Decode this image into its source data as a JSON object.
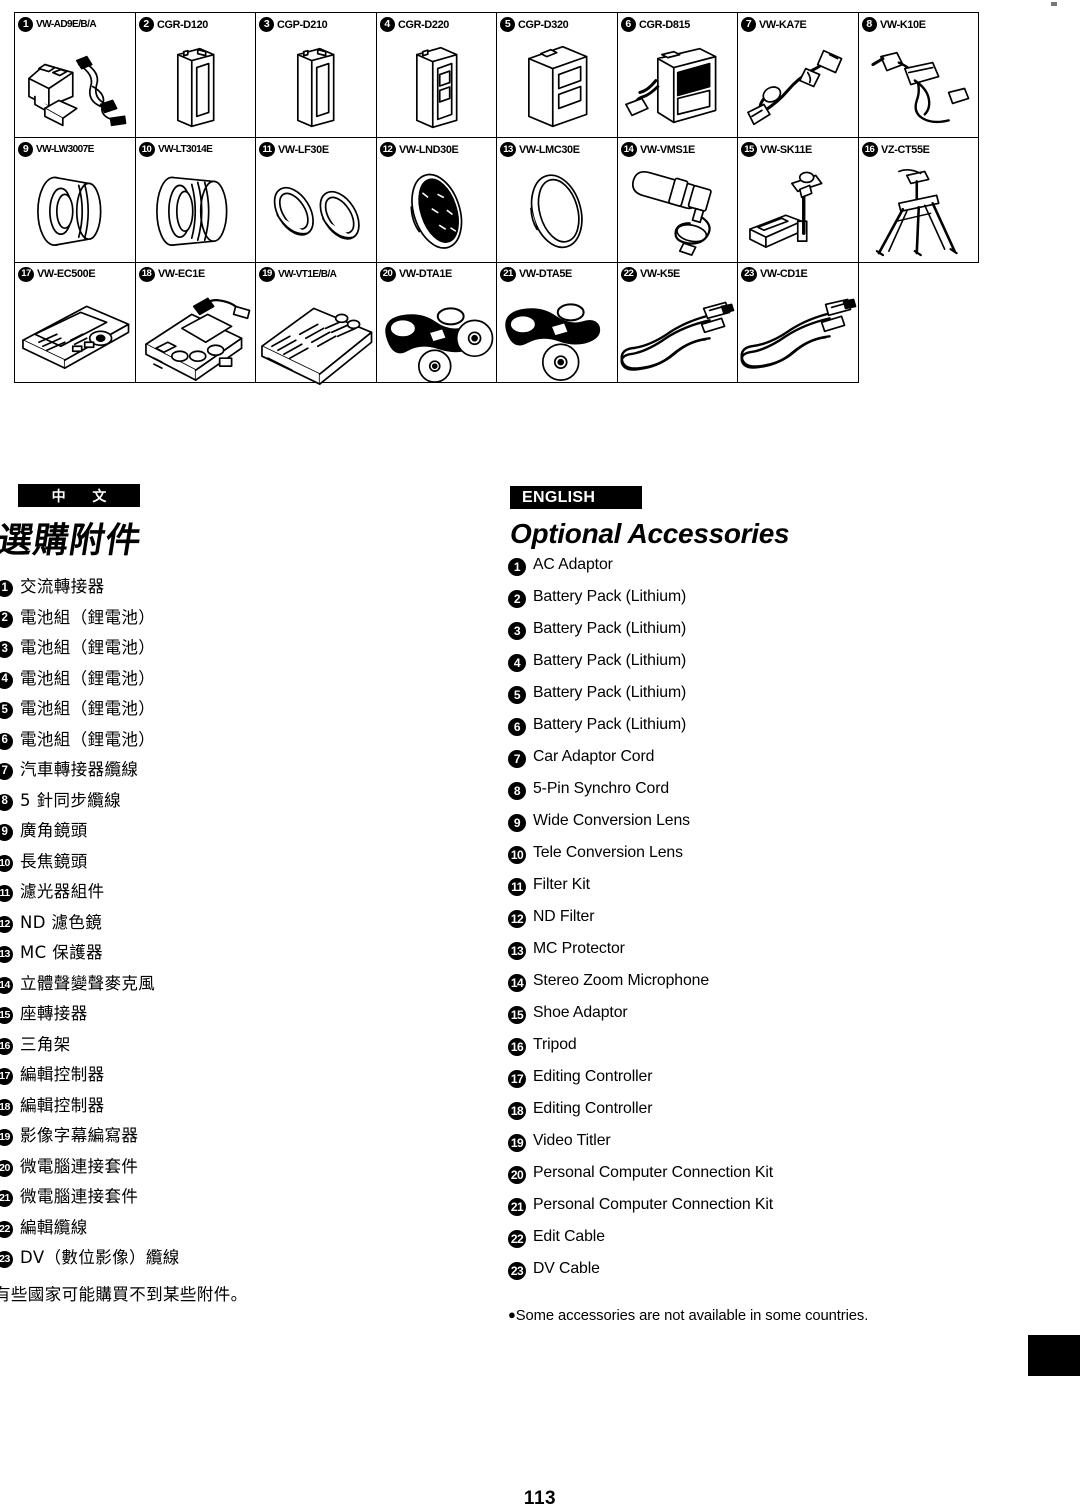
{
  "table": {
    "rows": [
      [
        {
          "n": "1",
          "code": "VW-AD9E/B/A",
          "art": "ac-adaptor"
        },
        {
          "n": "2",
          "code": "CGR-D120",
          "art": "battery-slim"
        },
        {
          "n": "3",
          "code": "CGP-D210",
          "art": "battery-slim"
        },
        {
          "n": "4",
          "code": "CGR-D220",
          "art": "battery-med"
        },
        {
          "n": "5",
          "code": "CGP-D320",
          "art": "battery-large"
        },
        {
          "n": "6",
          "code": "CGR-D815",
          "art": "battery-charger"
        },
        {
          "n": "7",
          "code": "VW-KA7E",
          "art": "car-adaptor-cord"
        },
        {
          "n": "8",
          "code": "VW-K10E",
          "art": "synchro-cord"
        }
      ],
      [
        {
          "n": "9",
          "code": "VW-LW3007E",
          "art": "wide-lens"
        },
        {
          "n": "10",
          "code": "VW-LT3014E",
          "art": "tele-lens"
        },
        {
          "n": "11",
          "code": "VW-LF30E",
          "art": "filter-kit"
        },
        {
          "n": "12",
          "code": "VW-LND30E",
          "art": "nd-filter"
        },
        {
          "n": "13",
          "code": "VW-LMC30E",
          "art": "mc-protector"
        },
        {
          "n": "14",
          "code": "VW-VMS1E",
          "art": "microphone"
        },
        {
          "n": "15",
          "code": "VW-SK11E",
          "art": "shoe-adaptor"
        },
        {
          "n": "16",
          "code": "VZ-CT55E",
          "art": "tripod"
        }
      ],
      [
        {
          "n": "17",
          "code": "VW-EC500E",
          "art": "editing-controller-a"
        },
        {
          "n": "18",
          "code": "VW-EC1E",
          "art": "editing-controller-b"
        },
        {
          "n": "19",
          "code": "VW-VT1E/B/A",
          "art": "video-titler"
        },
        {
          "n": "20",
          "code": "VW-DTA1E",
          "art": "pc-kit-a"
        },
        {
          "n": "21",
          "code": "VW-DTA5E",
          "art": "pc-kit-b"
        },
        {
          "n": "22",
          "code": "VW-K5E",
          "art": "edit-cable"
        },
        {
          "n": "23",
          "code": "VW-CD1E",
          "art": "dv-cable"
        },
        {
          "n": "",
          "code": "",
          "art": "empty"
        }
      ]
    ]
  },
  "chinese": {
    "band_label": "中 文",
    "title": "選購附件",
    "items": [
      {
        "n": "1",
        "label": "交流轉接器"
      },
      {
        "n": "2",
        "label": "電池組（鋰電池）"
      },
      {
        "n": "3",
        "label": "電池組（鋰電池）"
      },
      {
        "n": "4",
        "label": "電池組（鋰電池）"
      },
      {
        "n": "5",
        "label": "電池組（鋰電池）"
      },
      {
        "n": "6",
        "label": "電池組（鋰電池）"
      },
      {
        "n": "7",
        "label": "汽車轉接器纜線"
      },
      {
        "n": "8",
        "label": "5 針同步纜線"
      },
      {
        "n": "9",
        "label": "廣角鏡頭"
      },
      {
        "n": "10",
        "label": "長焦鏡頭"
      },
      {
        "n": "11",
        "label": "濾光器組件"
      },
      {
        "n": "12",
        "label": "ND 濾色鏡"
      },
      {
        "n": "13",
        "label": "MC 保護器"
      },
      {
        "n": "14",
        "label": "立體聲變聲麥克風"
      },
      {
        "n": "15",
        "label": "座轉接器"
      },
      {
        "n": "16",
        "label": "三角架"
      },
      {
        "n": "17",
        "label": "編輯控制器"
      },
      {
        "n": "18",
        "label": "編輯控制器"
      },
      {
        "n": "19",
        "label": "影像字幕編寫器"
      },
      {
        "n": "20",
        "label": "微電腦連接套件"
      },
      {
        "n": "21",
        "label": "微電腦連接套件"
      },
      {
        "n": "22",
        "label": "編輯纜線"
      },
      {
        "n": "23",
        "label": "DV（數位影像）纜線"
      }
    ],
    "note": "有些國家可能購買不到某些附件。"
  },
  "english": {
    "band_label": "ENGLISH",
    "title": "Optional Accessories",
    "items": [
      {
        "n": "1",
        "label": "AC Adaptor"
      },
      {
        "n": "2",
        "label": "Battery Pack (Lithium)"
      },
      {
        "n": "3",
        "label": "Battery Pack (Lithium)"
      },
      {
        "n": "4",
        "label": "Battery Pack (Lithium)"
      },
      {
        "n": "5",
        "label": "Battery Pack (Lithium)"
      },
      {
        "n": "6",
        "label": "Battery Pack (Lithium)"
      },
      {
        "n": "7",
        "label": "Car Adaptor Cord"
      },
      {
        "n": "8",
        "label": "5-Pin Synchro Cord"
      },
      {
        "n": "9",
        "label": "Wide Conversion Lens"
      },
      {
        "n": "10",
        "label": "Tele Conversion Lens"
      },
      {
        "n": "11",
        "label": "Filter Kit"
      },
      {
        "n": "12",
        "label": "ND Filter"
      },
      {
        "n": "13",
        "label": "MC Protector"
      },
      {
        "n": "14",
        "label": "Stereo Zoom Microphone"
      },
      {
        "n": "15",
        "label": "Shoe Adaptor"
      },
      {
        "n": "16",
        "label": "Tripod"
      },
      {
        "n": "17",
        "label": "Editing Controller"
      },
      {
        "n": "18",
        "label": "Editing Controller"
      },
      {
        "n": "19",
        "label": "Video Titler"
      },
      {
        "n": "20",
        "label": "Personal Computer Connection Kit"
      },
      {
        "n": "21",
        "label": "Personal Computer Connection Kit"
      },
      {
        "n": "22",
        "label": "Edit Cable"
      },
      {
        "n": "23",
        "label": "DV Cable"
      }
    ],
    "note": "Some accessories are not available in some countries.",
    "note_bullet": "●"
  },
  "page_number": "113"
}
